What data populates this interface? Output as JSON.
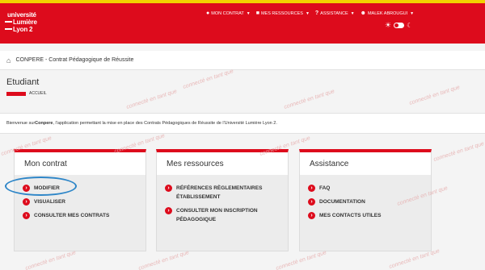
{
  "app": {
    "logo_lines": [
      "université",
      "Lumière",
      "Lyon 2"
    ],
    "brand_color": "#dd0b1c",
    "accent_border": "#f2d100"
  },
  "topnav": {
    "items": [
      {
        "icon": "comments-icon",
        "label": "MON CONTRAT"
      },
      {
        "icon": "folder-icon",
        "label": "MES RESSOURCES"
      },
      {
        "icon": "question-icon",
        "label": "ASSISTANCE"
      },
      {
        "icon": "user-icon",
        "label": "MALEK ABROUGUI"
      }
    ],
    "theme_toggle": {
      "left_icon": "sun-icon",
      "right_icon": "moon-icon"
    }
  },
  "breadcrumb": {
    "icon": "home-icon",
    "text": "CONPERE - Contrat Pédagogique de Réussite"
  },
  "page": {
    "title": "Etudiant",
    "subnav_label": "ACCUEIL"
  },
  "welcome": {
    "prefix": "Bienvenue sur ",
    "app_name": "Conpere",
    "suffix": ", l'application permettant la mise en place des Contrats Pédagogiques de Réussite de l'Université Lumière Lyon 2."
  },
  "cards": [
    {
      "title": "Mon contrat",
      "items": [
        "MODIFIER",
        "VISUALISER",
        "CONSULTER MES CONTRATS"
      ]
    },
    {
      "title": "Mes ressources",
      "items": [
        "RÉFÉRENCES RÈGLEMENTAIRES ÉTABLISSEMENT",
        "CONSULTER MON INSCRIPTION PÉDAGOGIQUE"
      ]
    },
    {
      "title": "Assistance",
      "items": [
        "FAQ",
        "DOCUMENTATION",
        "MES CONTACTS UTILES"
      ]
    }
  ],
  "watermark": "connecté en tant que",
  "highlight_color": "#2e86c8"
}
